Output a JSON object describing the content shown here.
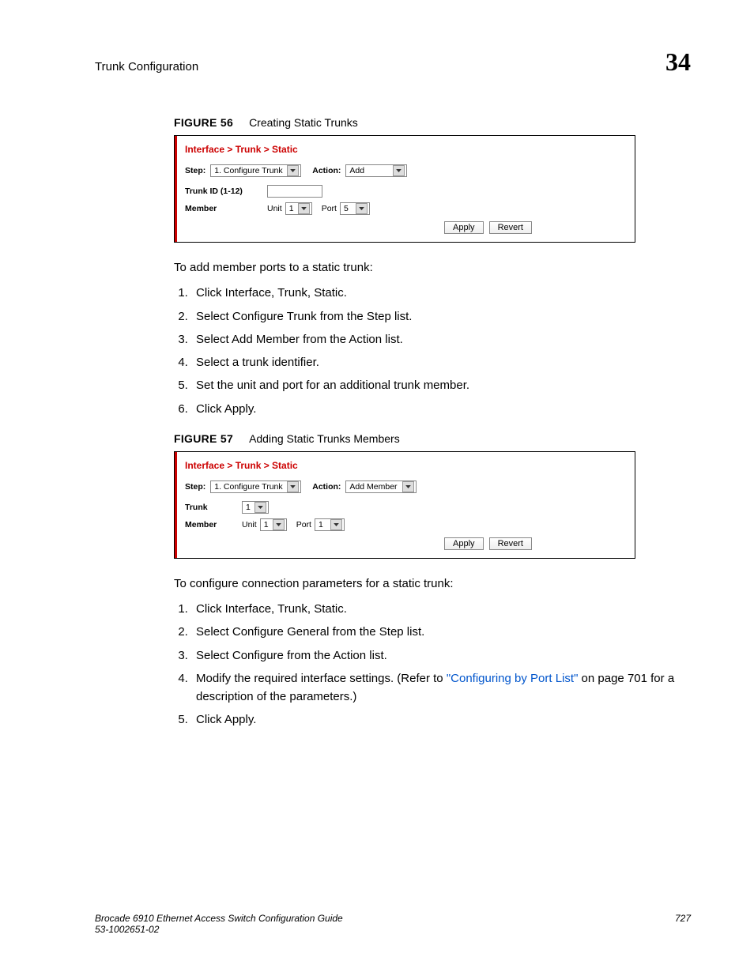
{
  "header": {
    "title": "Trunk Configuration",
    "chapter": "34"
  },
  "figure56": {
    "label": "FIGURE 56",
    "caption": "Creating Static Trunks",
    "breadcrumb": "Interface > Trunk > Static",
    "step_label": "Step:",
    "step_value": "1. Configure Trunk",
    "action_label": "Action:",
    "action_value": "Add",
    "trunk_id_label": "Trunk ID (1-12)",
    "member_label": "Member",
    "unit_label": "Unit",
    "unit_value": "1",
    "port_label": "Port",
    "port_value": "5",
    "apply": "Apply",
    "revert": "Revert"
  },
  "para1": "To add member ports to a static trunk:",
  "steps1": [
    "Click Interface, Trunk, Static.",
    "Select Configure Trunk from the Step list.",
    "Select Add Member from the Action list.",
    "Select a trunk identifier.",
    "Set the unit and port for an additional trunk member.",
    "Click Apply."
  ],
  "figure57": {
    "label": "FIGURE 57",
    "caption": "Adding Static Trunks Members",
    "breadcrumb": "Interface > Trunk > Static",
    "step_label": "Step:",
    "step_value": "1. Configure Trunk",
    "action_label": "Action:",
    "action_value": "Add Member",
    "trunk_label": "Trunk",
    "trunk_value": "1",
    "member_label": "Member",
    "unit_label": "Unit",
    "unit_value": "1",
    "port_label": "Port",
    "port_value": "1",
    "apply": "Apply",
    "revert": "Revert"
  },
  "para2": "To configure connection parameters for a static trunk:",
  "steps2": {
    "s1": "Click Interface, Trunk, Static.",
    "s2": "Select Configure General from the Step list.",
    "s3": "Select Configure from the Action list.",
    "s4a": "Modify the required interface settings. (Refer to ",
    "s4link": "\"Configuring by Port List\"",
    "s4b": " on page 701 for a description of the parameters.)",
    "s5": "Click Apply."
  },
  "footer": {
    "line1": "Brocade 6910 Ethernet Access Switch Configuration Guide",
    "line2": "53-1002651-02",
    "page": "727"
  }
}
